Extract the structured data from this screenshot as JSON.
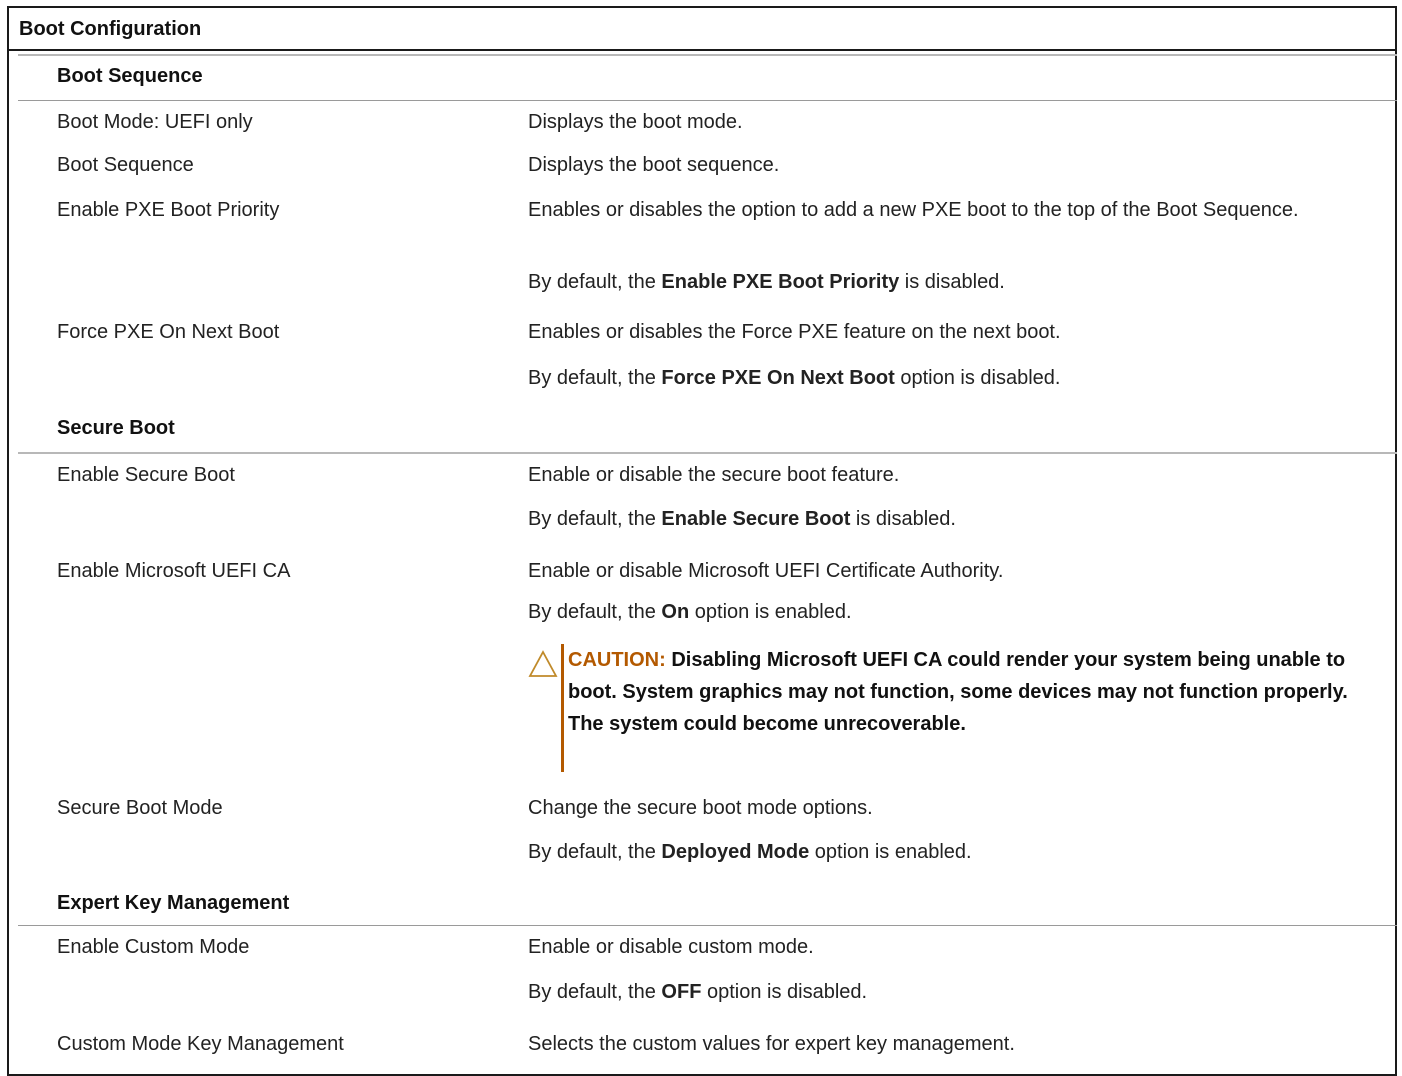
{
  "title": "Boot Configuration",
  "sections": [
    {
      "heading": "Boot Sequence",
      "rows": [
        {
          "option": "Boot Mode: UEFI only",
          "desc": [
            "Displays the boot mode."
          ]
        },
        {
          "option": "Boot Sequence",
          "desc": [
            "Displays the boot sequence."
          ]
        },
        {
          "option": "Enable PXE Boot Priority",
          "desc": [
            "Enables or disables the option to add a new PXE boot to the top of the Boot Sequence."
          ],
          "default": {
            "pre": "By default, the ",
            "bold": "Enable PXE Boot Priority",
            "post": " is disabled."
          }
        },
        {
          "option": "Force PXE On Next Boot",
          "desc": [
            "Enables or disables the Force PXE feature on the next boot."
          ],
          "default": {
            "pre": "By default, the ",
            "bold": "Force PXE On Next Boot",
            "post": " option is disabled."
          }
        }
      ]
    },
    {
      "heading": "Secure Boot",
      "rows": [
        {
          "option": "Enable Secure Boot",
          "desc": [
            "Enable or disable the secure boot feature."
          ],
          "default": {
            "pre": "By default, the ",
            "bold": "Enable Secure Boot",
            "post": " is disabled."
          }
        },
        {
          "option": "Enable Microsoft UEFI CA",
          "desc": [
            "Enable or disable Microsoft UEFI Certificate Authority."
          ],
          "default": {
            "pre": "By default, the ",
            "bold": "On",
            "post": " option is enabled."
          },
          "caution": {
            "label": "CAUTION:",
            "text": " Disabling Microsoft UEFI CA could render your system being unable to boot. System graphics may not function, some devices may not function properly. The system could become unrecoverable."
          }
        },
        {
          "option": "Secure Boot Mode",
          "desc": [
            "Change the secure boot mode options."
          ],
          "default": {
            "pre": "By default, the ",
            "bold": "Deployed Mode",
            "post": " option is enabled."
          }
        }
      ]
    },
    {
      "heading": "Expert Key Management",
      "rows": [
        {
          "option": "Enable Custom Mode",
          "desc": [
            "Enable or disable custom mode."
          ],
          "default": {
            "pre": "By default, the ",
            "bold": "OFF",
            "post": " option is disabled."
          }
        },
        {
          "option": "Custom Mode Key Management",
          "desc": [
            "Selects the custom values for expert key management."
          ]
        }
      ]
    }
  ],
  "colors": {
    "caution": "#b35900",
    "border": "#1a1a1a",
    "rule": "#b8b8b8"
  },
  "icons": {
    "caution": "warning-triangle-icon"
  }
}
